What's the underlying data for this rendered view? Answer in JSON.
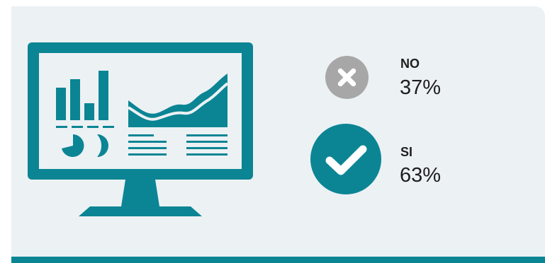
{
  "colors": {
    "accent": "#0b8594",
    "negative_icon": "#a7a7a7",
    "panel_background": "#ecf1f4",
    "text": "#1e1e1e"
  },
  "illustration": {
    "icon": "monitor-dashboard-icon"
  },
  "results": [
    {
      "label": "NO",
      "value": "37%",
      "icon": "cross-circle-icon",
      "share": 0.37
    },
    {
      "label": "SI",
      "value": "63%",
      "icon": "check-circle-icon",
      "share": 0.63
    }
  ]
}
